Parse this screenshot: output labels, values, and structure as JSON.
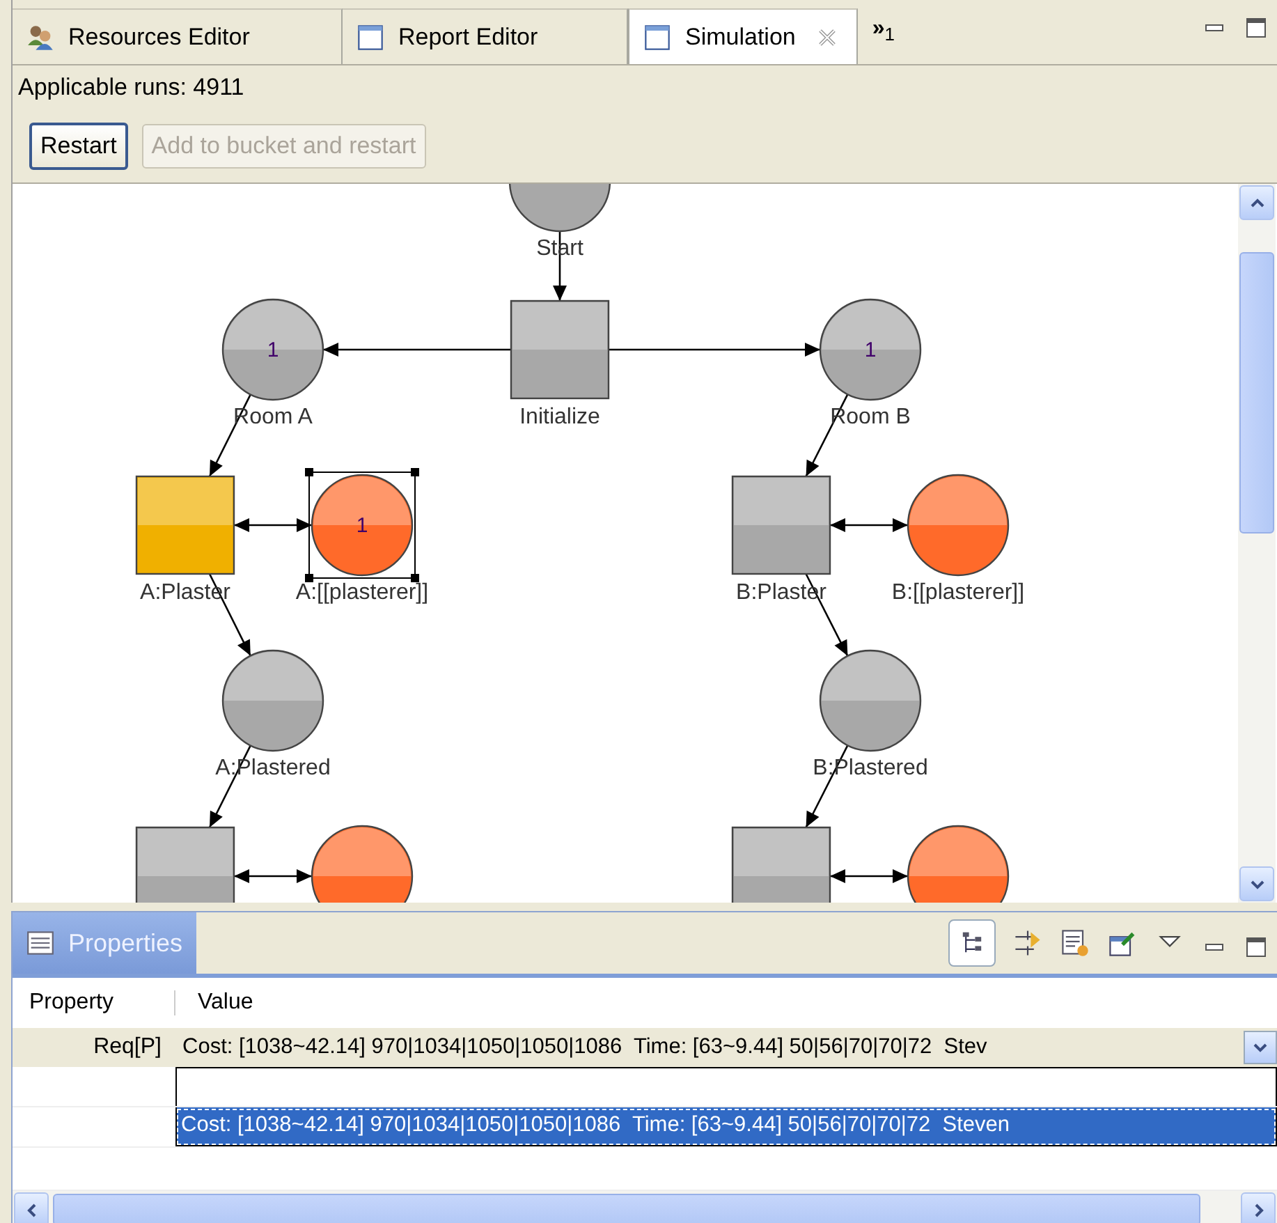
{
  "tabs": [
    {
      "label": "Resources Editor",
      "kind": "resources",
      "selected": false
    },
    {
      "label": "Report Editor",
      "kind": "editor",
      "selected": false
    },
    {
      "label": "Simulation",
      "kind": "editor",
      "selected": true
    }
  ],
  "overflow": {
    "glyph": "»",
    "count": "1"
  },
  "status": "Applicable runs: 4911",
  "buttons": [
    {
      "label": "Restart",
      "disabled": false
    },
    {
      "label": "Add to bucket and restart",
      "disabled": true
    }
  ],
  "diagram": {
    "nodes": [
      {
        "kind": "place",
        "label": "Start",
        "color": "#a8a8a8",
        "selected": false
      },
      {
        "kind": "place",
        "label": "Room A",
        "token": "1",
        "color": "#a8a8a8",
        "selected": false
      },
      {
        "kind": "transition",
        "label": "Initialize",
        "color": "#a8a8a8",
        "selected": false
      },
      {
        "kind": "place",
        "label": "Room B",
        "token": "1",
        "color": "#a8a8a8",
        "selected": false
      },
      {
        "kind": "transition",
        "label": "A:Plaster",
        "color": "#f0b000",
        "selected": false
      },
      {
        "kind": "place",
        "label": "A:[[plasterer]]",
        "token": "1",
        "color": "#ff6a2a",
        "selected": true
      },
      {
        "kind": "transition",
        "label": "B:Plaster",
        "color": "#a8a8a8",
        "selected": false
      },
      {
        "kind": "place",
        "label": "B:[[plasterer]]",
        "color": "#ff6a2a",
        "selected": false
      },
      {
        "kind": "place",
        "label": "A:Plastered",
        "color": "#a8a8a8",
        "selected": false
      },
      {
        "kind": "place",
        "label": "B:Plastered",
        "color": "#a8a8a8",
        "selected": false
      },
      {
        "kind": "transition",
        "color": "#a8a8a8",
        "selected": false
      },
      {
        "kind": "place",
        "color": "#ff6a2a",
        "selected": false
      },
      {
        "kind": "transition",
        "color": "#a8a8a8",
        "selected": false
      },
      {
        "kind": "place",
        "color": "#ff6a2a",
        "selected": false
      }
    ]
  },
  "properties": {
    "tab": "Properties",
    "columns": [
      "Property",
      "Value"
    ],
    "rows": [
      {
        "property": "Req[P]",
        "value": "Cost: [1038~42.14] 970|1034|1050|1050|1086  Time: [63~9.44] 50|56|70|70|72  Stev"
      }
    ],
    "options": [
      {
        "label": "Cost: [1038~42.14] 970|1034|1050|1050|1086  Time: [63~9.44] 50|56|70|70|72  Steven",
        "selected": true
      }
    ]
  }
}
